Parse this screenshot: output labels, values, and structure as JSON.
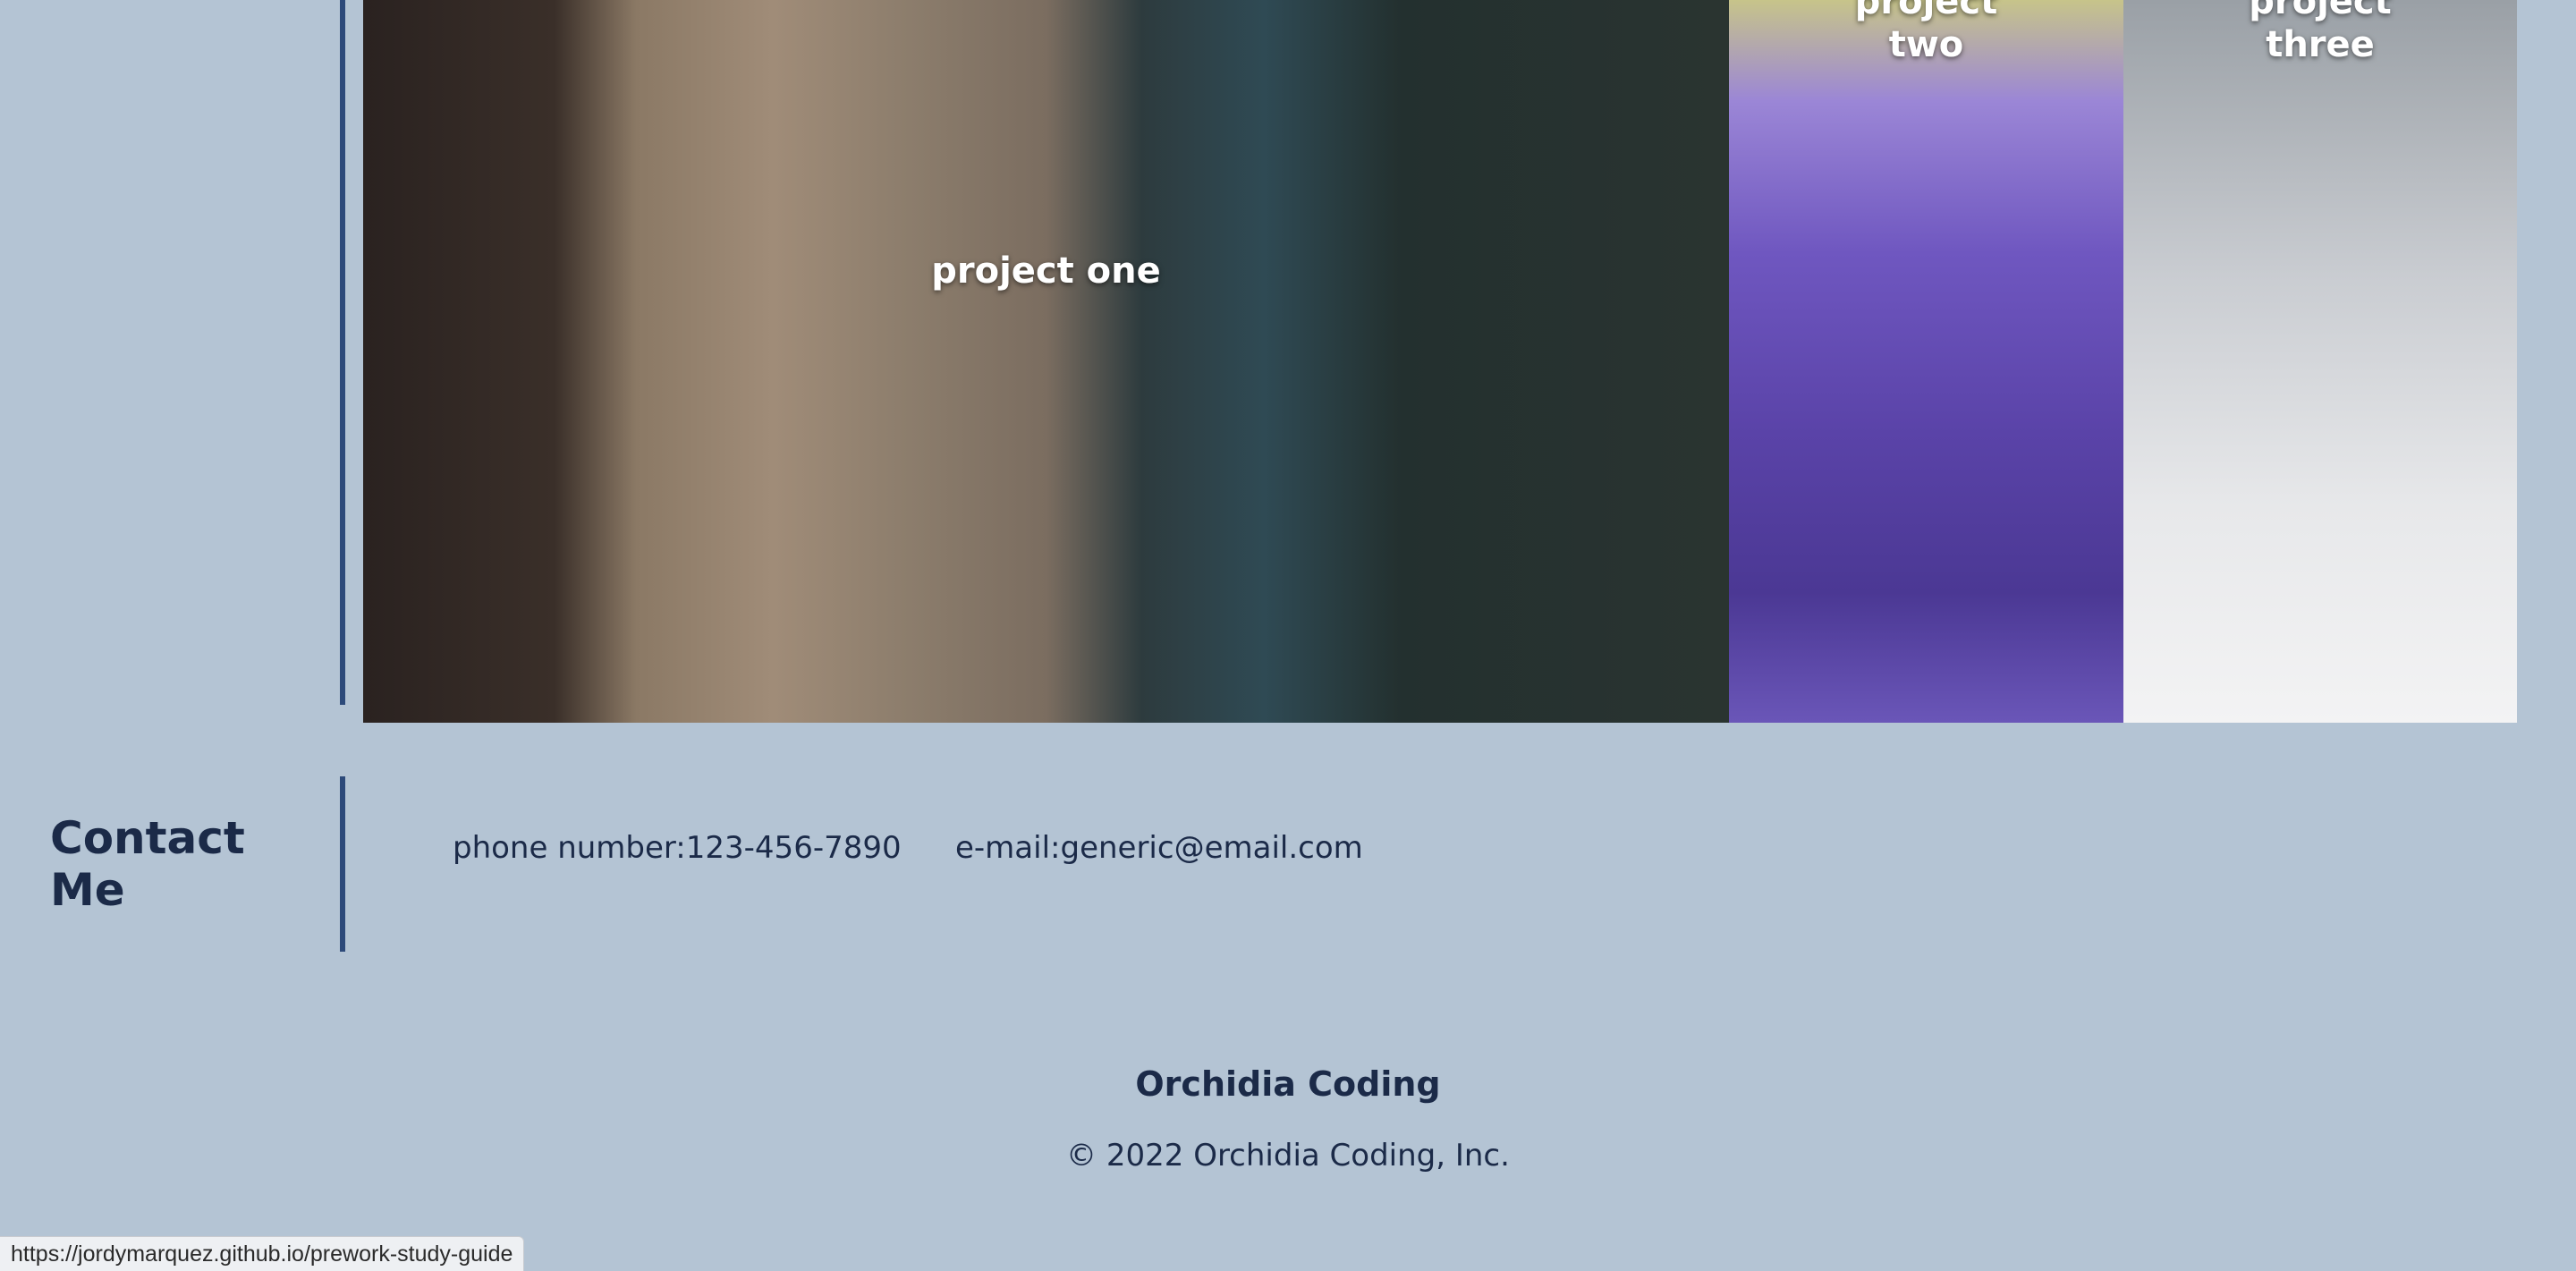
{
  "projects": [
    {
      "label": "project one"
    },
    {
      "label": "project\ntwo"
    },
    {
      "label": "project\nthree"
    }
  ],
  "contact": {
    "title": "Contact Me",
    "phone": "phone number:123-456-7890",
    "email": "e-mail:generic@email.com"
  },
  "footer": {
    "brand": "Orchidia Coding",
    "copyright": "© 2022 Orchidia Coding, Inc."
  },
  "status_bar": {
    "url": "https://jordymarquez.github.io/prework-study-guide"
  },
  "colors": {
    "background": "#b4c4d4",
    "text": "#1b2a48",
    "rule": "#2d4a7a"
  }
}
